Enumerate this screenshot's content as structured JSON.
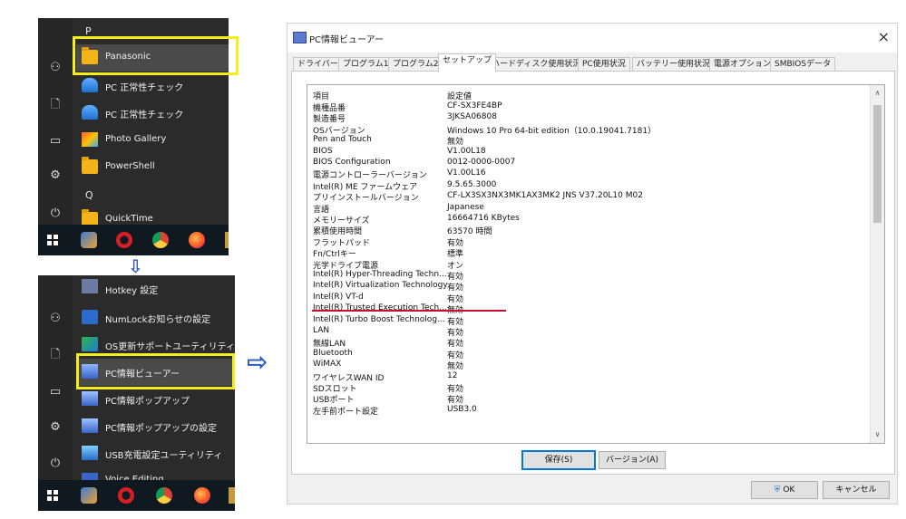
{
  "menu1": {
    "letters": [
      "P",
      "Q"
    ],
    "apps": [
      {
        "label": "Panasonic",
        "icon": "folder-icon"
      },
      {
        "label": "PC 正常性チェック",
        "icon": "pc-health-icon"
      },
      {
        "label": "PC 正常性チェック",
        "icon": "pc-health-icon"
      },
      {
        "label": "Photo Gallery",
        "icon": "photo-gallery-icon"
      },
      {
        "label": "PowerShell",
        "icon": "folder-icon"
      },
      {
        "label": "QuickTime",
        "icon": "folder-icon"
      }
    ]
  },
  "menu2": {
    "apps": [
      {
        "label": "Hotkey 設定",
        "icon": "hotkey-icon"
      },
      {
        "label": "NumLockお知らせの設定",
        "icon": "numlock-icon"
      },
      {
        "label": "OS更新サポートユーティリティ",
        "icon": "os-update-icon"
      },
      {
        "label": "PC情報ビューアー",
        "icon": "pc-info-viewer-icon"
      },
      {
        "label": "PC情報ポップアップ",
        "icon": "pc-info-popup-icon"
      },
      {
        "label": "PC情報ポップアップの設定",
        "icon": "pc-info-popup-settings-icon"
      },
      {
        "label": "USB充電設定ユーティリティ",
        "icon": "usb-charge-icon"
      },
      {
        "label": "Voice Editing",
        "icon": "voice-editing-icon"
      }
    ]
  },
  "window": {
    "title": "PC情報ビューアー",
    "close": "×",
    "tabs": [
      "ドライバー",
      "プログラム1",
      "プログラム2",
      "セットアップ",
      "ハードディスク使用状況",
      "PC使用状況",
      "バッテリー使用状況",
      "電源オプション",
      "SMBIOSデータ"
    ],
    "active_tab": "セットアップ",
    "columns": [
      "項目",
      "設定値"
    ],
    "rows": [
      [
        "機種品番",
        "CF-SX3FE4BP"
      ],
      [
        "製造番号",
        "3JKSA06808"
      ],
      [
        "OSバージョン",
        "Windows 10 Pro 64-bit edition（10.0.19041.7181）"
      ],
      [
        " Pen and Touch",
        "無効"
      ],
      [
        "BIOS",
        "V1.00L18"
      ],
      [
        "BIOS Configuration",
        "0012-0000-0007"
      ],
      [
        "電源コントローラーバージョン",
        "V1.00L16"
      ],
      [
        "Intel(R) ME ファームウェア",
        "9.5.65.3000"
      ],
      [
        "プリインストールバージョン",
        "CF-LX3SX3NX3MK1AX3MK2 JNS V37.20L10 M02"
      ],
      [
        "言語",
        "Japanese"
      ],
      [
        "メモリーサイズ",
        "16664716 KBytes"
      ],
      [
        "累積使用時間",
        "63570 時間"
      ],
      [
        "フラットパッド",
        "有効"
      ],
      [
        "Fn/Ctrlキー",
        "標準"
      ],
      [
        "光学ドライブ電源",
        "オン"
      ],
      [
        "Intel(R) Hyper-Threading Techn...",
        "有効"
      ],
      [
        "Intel(R) Virtualization Technology",
        "有効"
      ],
      [
        " Intel(R) VT-d",
        "有効"
      ],
      [
        "Intel(R) Trusted Execution Tech...",
        "無効"
      ],
      [
        "Intel(R) Turbo Boost Technolog...",
        "有効"
      ],
      [
        "LAN",
        "有効"
      ],
      [
        "無線LAN",
        "有効"
      ],
      [
        "Bluetooth",
        "有効"
      ],
      [
        "WiMAX",
        "無効"
      ],
      [
        "ワイヤレスWAN ID",
        "12"
      ],
      [
        "SDスロット",
        "有効"
      ],
      [
        "USBポート",
        "有効"
      ],
      [
        " 左手前ポート設定",
        "USB3.0"
      ]
    ],
    "buttons": {
      "save": "保存(S)",
      "version": "バージョン(A)",
      "ok": "OK",
      "cancel": "キャンセル"
    }
  },
  "colors": {
    "highlight": "#f4ee1c",
    "underline": "#c8102e",
    "arrow": "#2f56c8"
  }
}
